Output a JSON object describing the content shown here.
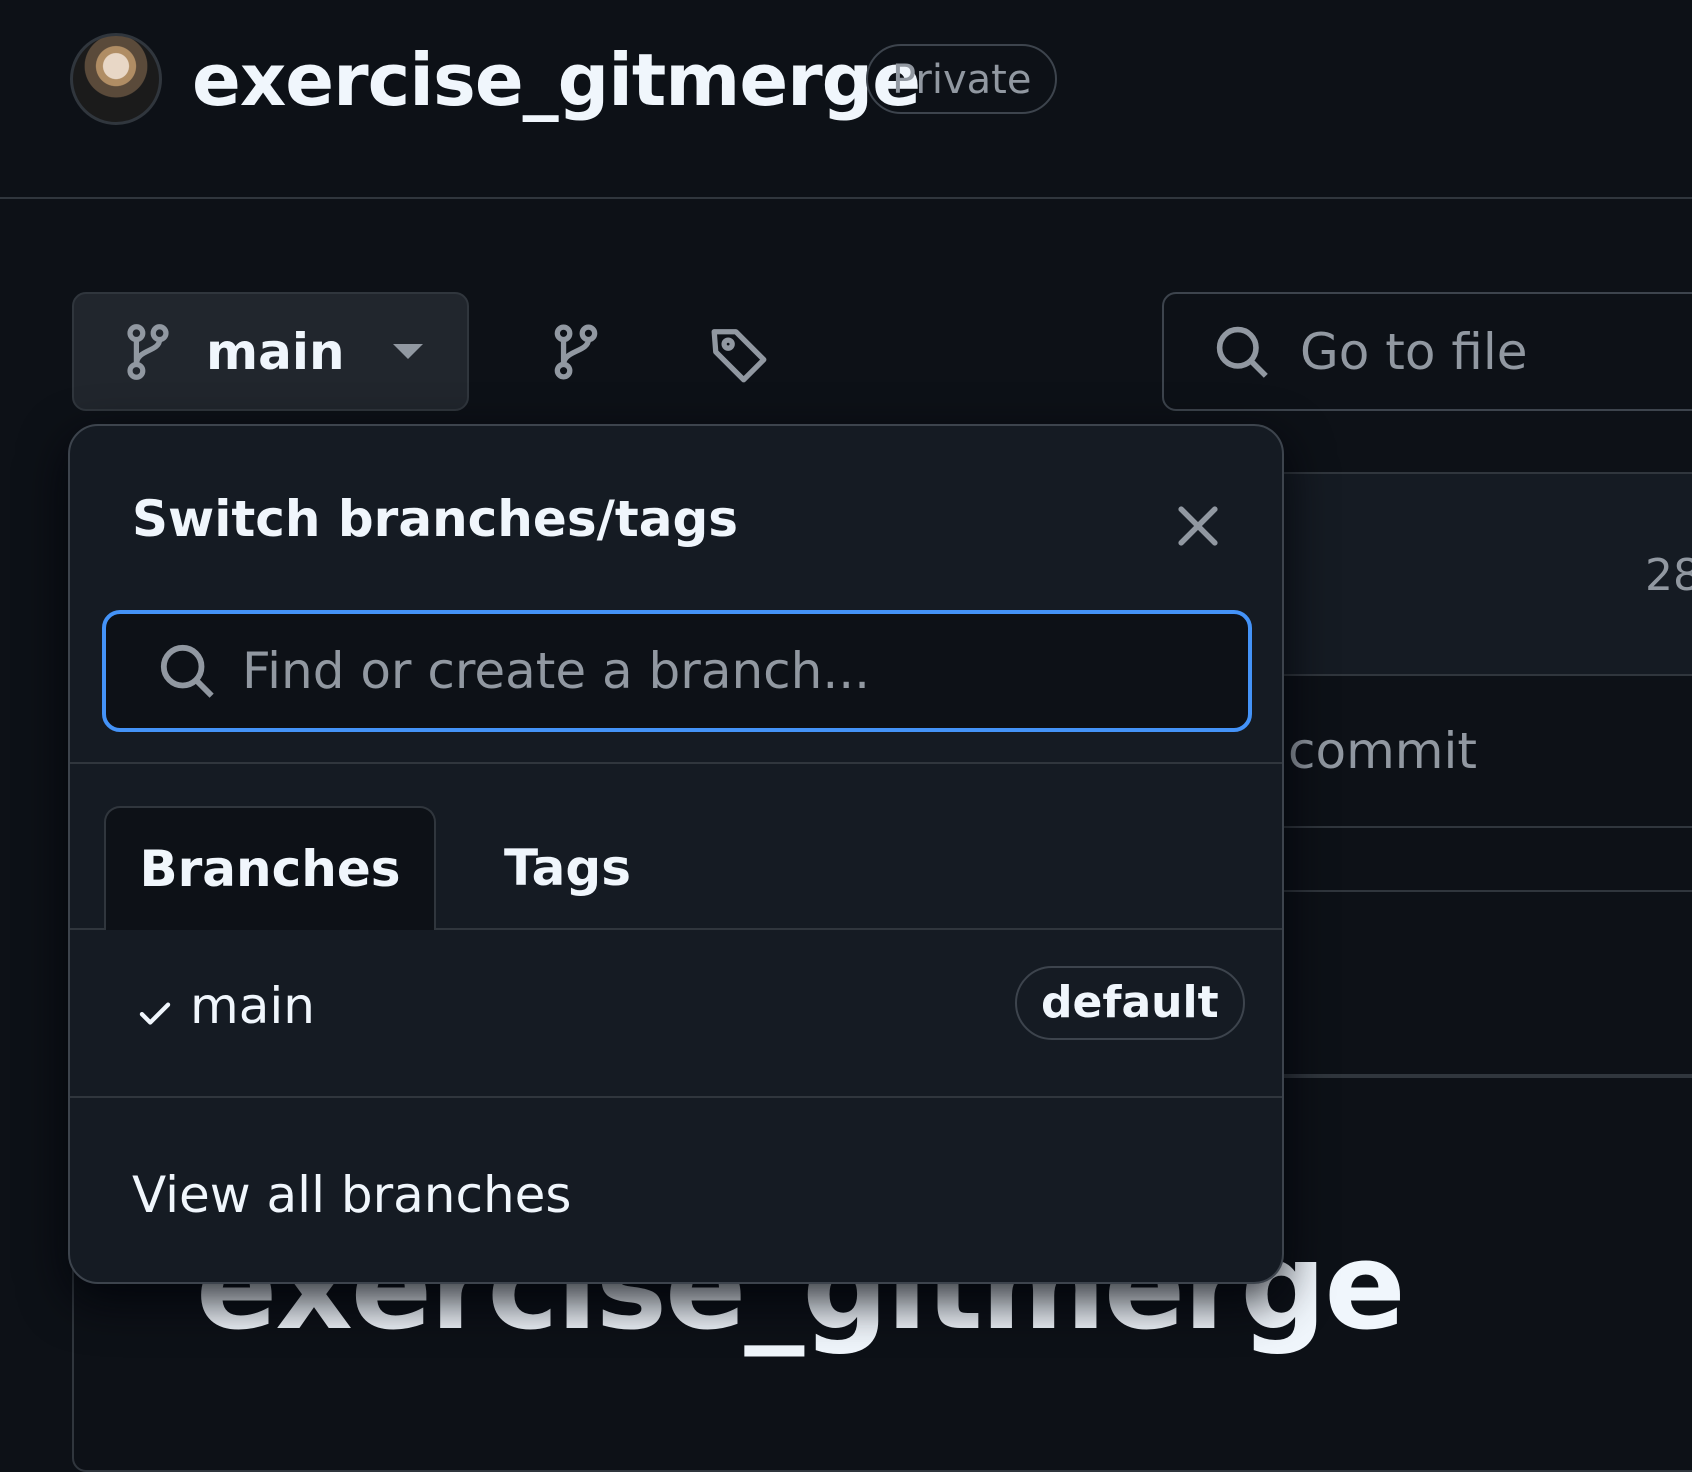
{
  "header": {
    "repo_name": "exercise_gitmerge",
    "visibility": "Private"
  },
  "toolbar": {
    "branch_label": "main",
    "goto_placeholder": "Go to file"
  },
  "background": {
    "count_partial": "28",
    "commit_partial": "commit",
    "readme_title": "exercise_gitmerge"
  },
  "branch_popup": {
    "title": "Switch branches/tags",
    "search_placeholder": "Find or create a branch...",
    "tabs": [
      {
        "label": "Branches",
        "selected": true
      },
      {
        "label": "Tags",
        "selected": false
      }
    ],
    "items": [
      {
        "name": "main",
        "badge": "default",
        "checked": true
      }
    ],
    "footer_link": "View all branches"
  },
  "colors": {
    "background": "#0d1117",
    "popup": "#151b23",
    "focus_ring": "#4493f8",
    "text_primary": "#f0f6fc",
    "text_muted": "#9198a1",
    "border": "#30363d"
  }
}
